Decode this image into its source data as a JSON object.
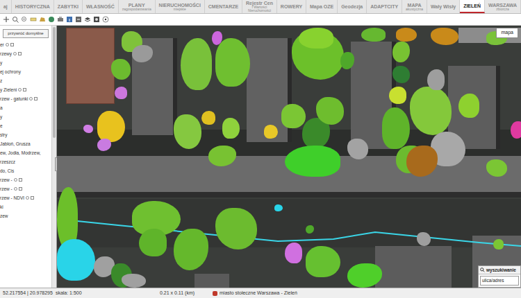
{
  "tabs": [
    {
      "lines": [
        "aj"
      ],
      "selected": false
    },
    {
      "lines": [
        "HISTORYCZNA"
      ],
      "selected": false
    },
    {
      "lines": [
        "ZABYTKI"
      ],
      "selected": false
    },
    {
      "lines": [
        "WŁASNOŚĆ"
      ],
      "selected": false
    },
    {
      "lines": [
        "PLANY",
        "zagospodarowania"
      ],
      "selected": false
    },
    {
      "lines": [
        "NIERUCHOMOŚCI",
        "miejskie"
      ],
      "selected": false
    },
    {
      "lines": [
        "CMENTARZE"
      ],
      "selected": false
    },
    {
      "lines": [
        "Rejestr Cen",
        "i Wartości",
        "Nieruchomości"
      ],
      "selected": false
    },
    {
      "lines": [
        "ROWERY"
      ],
      "selected": false
    },
    {
      "lines": [
        "Mapa OZE"
      ],
      "selected": false
    },
    {
      "lines": [
        "Geodezja"
      ],
      "selected": false
    },
    {
      "lines": [
        "ADAPTCITY"
      ],
      "selected": false
    },
    {
      "lines": [
        "MAPA",
        "akustyczna"
      ],
      "selected": false
    },
    {
      "lines": [
        "Wały Wisły"
      ],
      "selected": false
    },
    {
      "lines": [
        "ZIELEŃ"
      ],
      "selected": true
    },
    {
      "lines": [
        "WARSZAWA",
        "zbiorcza"
      ],
      "selected": false
    }
  ],
  "panel": {
    "reset_button": "przywróć domyślne"
  },
  "layers": [
    {
      "label": "er",
      "kind": "toggle"
    },
    {
      "label": "rzewy",
      "kind": "toggle"
    },
    {
      "label": "y",
      "kind": "text"
    },
    {
      "label": "ej ochrony",
      "kind": "text"
    },
    {
      "label": "z",
      "kind": "text"
    },
    {
      "label": "y Zieleni",
      "kind": "toggle"
    },
    {
      "label": "rzew - gatunki",
      "kind": "toggle"
    },
    {
      "label": "a",
      "kind": "text"
    },
    {
      "label": "y",
      "kind": "text"
    },
    {
      "label": "e",
      "kind": "text"
    },
    {
      "label": "stry",
      "kind": "text"
    },
    {
      "label": "Jabłoń, Grusza",
      "kind": "text"
    },
    {
      "label": "ew, Jodła, Modrzew,",
      "kind": "text"
    },
    {
      "label": "rzeszcz",
      "kind": "text"
    },
    {
      "label": "do, Cis",
      "kind": "text"
    },
    {
      "label": "rzew -",
      "kind": "toggle"
    },
    {
      "label": "rzew -",
      "kind": "toggle"
    },
    {
      "label": "rzew - NDVI",
      "kind": "toggle"
    },
    {
      "label": "ki",
      "kind": "text"
    },
    {
      "label": "zew",
      "kind": "text"
    }
  ],
  "map": {
    "map_button": "mapa"
  },
  "trees": [
    {
      "color": "#7fc23a"
    },
    {
      "color": "#9a9a9a"
    },
    {
      "color": "#6cbb2f"
    },
    {
      "color": "#cc77dd"
    },
    {
      "color": "#e8c21e"
    },
    {
      "color": "#c97be0"
    },
    {
      "color": "#d07ee5"
    },
    {
      "color": "#79c13a"
    },
    {
      "color": "#6fbf30"
    },
    {
      "color": "#cc66dd"
    },
    {
      "color": "#85c840"
    },
    {
      "color": "#e0c020"
    },
    {
      "color": "#8fd13c"
    },
    {
      "color": "#78c232"
    },
    {
      "color": "#6cc02a"
    },
    {
      "color": "#88d22f"
    },
    {
      "color": "#7bc634"
    },
    {
      "color": "#3a8a2a"
    },
    {
      "color": "#6ebd2e"
    },
    {
      "color": "#3fcf2a"
    },
    {
      "color": "#e8c828"
    },
    {
      "color": "#4fa82a"
    },
    {
      "color": "#a3a3a3"
    },
    {
      "color": "#66b830"
    },
    {
      "color": "#c98a1a"
    },
    {
      "color": "#78c232"
    },
    {
      "color": "#2e7d32"
    },
    {
      "color": "#c8e030"
    },
    {
      "color": "#5fb42a"
    },
    {
      "color": "#6cbb2f"
    },
    {
      "color": "#84c83b"
    },
    {
      "color": "#9e9e9e"
    },
    {
      "color": "#a8a8a8"
    },
    {
      "color": "#a86a1c"
    },
    {
      "color": "#c98a1a"
    },
    {
      "color": "#8ed12f"
    },
    {
      "color": "#7ac23a"
    },
    {
      "color": "#e03aa0"
    },
    {
      "color": "#7bc634"
    },
    {
      "color": "#6cbf2a"
    },
    {
      "color": "#6fc030"
    },
    {
      "color": "#65b82c"
    },
    {
      "color": "#6cbb2f"
    },
    {
      "color": "#5fb42a"
    },
    {
      "color": "#29d4e8"
    },
    {
      "color": "#a0a0a0"
    },
    {
      "color": "#3a8a2a"
    },
    {
      "color": "#d070e0"
    },
    {
      "color": "#66c030"
    },
    {
      "color": "#4fcf2a"
    },
    {
      "color": "#9e9e9e"
    },
    {
      "color": "#7bc634"
    },
    {
      "color": "#29d4e8"
    },
    {
      "color": "#4fa82a"
    },
    {
      "color": "#a0a0a0"
    }
  ],
  "search": {
    "title": "wyszukiwanie",
    "field": "ulica/adres"
  },
  "status_bar": {
    "coords": "52.217554 | 20.978295",
    "scale": "skala: 1:500",
    "extent": "0.21 x 0.11 (km)",
    "source": "miasto stołeczne Warszawa - Zieleń"
  }
}
